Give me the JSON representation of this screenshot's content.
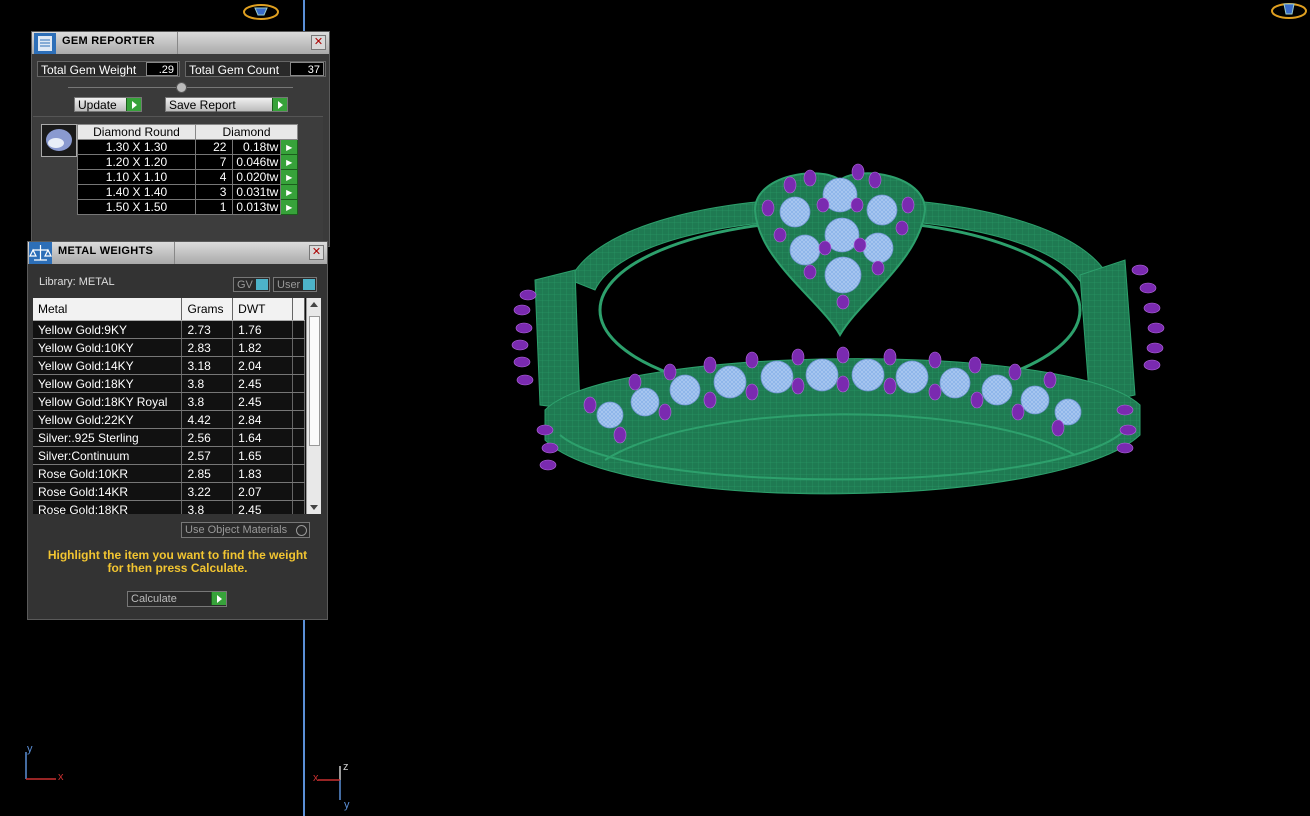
{
  "gem_reporter": {
    "title": "GEM REPORTER",
    "total_weight_label": "Total Gem Weight",
    "total_weight_value": ".29",
    "total_count_label": "Total Gem Count",
    "total_count_value": "37",
    "update_label": "Update",
    "save_label": "Save Report",
    "table_header_shape": "Diamond Round",
    "table_header_material": "Diamond",
    "rows": [
      {
        "size": "1.30 X 1.30",
        "count": "22",
        "weight": "0.18tw"
      },
      {
        "size": "1.20 X 1.20",
        "count": "7",
        "weight": "0.046tw"
      },
      {
        "size": "1.10 X 1.10",
        "count": "4",
        "weight": "0.020tw"
      },
      {
        "size": "1.40 X 1.40",
        "count": "3",
        "weight": "0.031tw"
      },
      {
        "size": "1.50 X 1.50",
        "count": "1",
        "weight": "0.013tw"
      }
    ]
  },
  "metal_weights": {
    "title": "METAL WEIGHTS",
    "library_label": "Library: METAL",
    "gv_label": "GV",
    "user_label": "User",
    "headers": {
      "metal": "Metal",
      "grams": "Grams",
      "dwt": "DWT"
    },
    "rows": [
      {
        "metal": "Yellow Gold:9KY",
        "grams": "2.73",
        "dwt": "1.76"
      },
      {
        "metal": "Yellow Gold:10KY",
        "grams": "2.83",
        "dwt": "1.82"
      },
      {
        "metal": "Yellow Gold:14KY",
        "grams": "3.18",
        "dwt": "2.04"
      },
      {
        "metal": "Yellow Gold:18KY",
        "grams": "3.8",
        "dwt": "2.45"
      },
      {
        "metal": "Yellow Gold:18KY Royal",
        "grams": "3.8",
        "dwt": "2.45"
      },
      {
        "metal": "Yellow Gold:22KY",
        "grams": "4.42",
        "dwt": "2.84"
      },
      {
        "metal": "Silver:.925 Sterling",
        "grams": "2.56",
        "dwt": "1.64"
      },
      {
        "metal": "Silver:Continuum",
        "grams": "2.57",
        "dwt": "1.65"
      },
      {
        "metal": "Rose Gold:10KR",
        "grams": "2.85",
        "dwt": "1.83"
      },
      {
        "metal": "Rose Gold:14KR",
        "grams": "3.22",
        "dwt": "2.07"
      },
      {
        "metal": "Rose Gold:18KR",
        "grams": "3.8",
        "dwt": "2.45"
      }
    ],
    "use_object_materials_label": "Use Object Materials",
    "hint": "Highlight the item you want to find the weight for then press Calculate.",
    "calculate_label": "Calculate"
  },
  "viewport": {
    "axis_left": {
      "up": "y",
      "right": "x"
    },
    "axis_mid": {
      "up": "z",
      "down": "y",
      "left": "x"
    }
  },
  "colors": {
    "ring_metal": "#1f7a52",
    "gem": "#8fb6ea",
    "prong": "#7a2ab0",
    "hint_text": "#f2c531",
    "accent_line": "#5b8fd6"
  }
}
